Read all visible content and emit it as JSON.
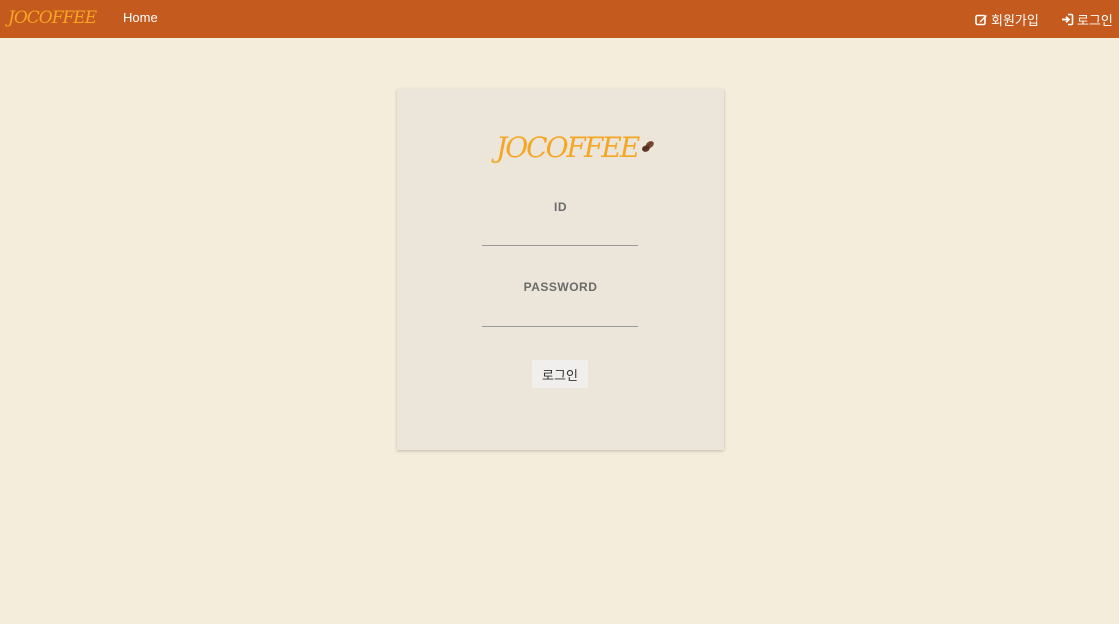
{
  "navbar": {
    "brand_text": "JOCOFFEE",
    "home_label": "Home",
    "signup_label": "회원가입",
    "login_label": "로그인"
  },
  "login_card": {
    "logo_text": "JOCOFFEE",
    "id_label": "ID",
    "id_value": "",
    "password_label": "PASSWORD",
    "password_value": "",
    "submit_label": "로그인"
  },
  "colors": {
    "navbar_bg": "#c45a1e",
    "page_bg": "#f4eddb",
    "card_bg": "#ece6da",
    "brand_accent": "#f5a623",
    "coffee_bean": "#6b3e2a"
  },
  "icons": {
    "signup": "edit-icon",
    "login": "sign-in-icon",
    "brand": "coffee-bean-icon"
  }
}
